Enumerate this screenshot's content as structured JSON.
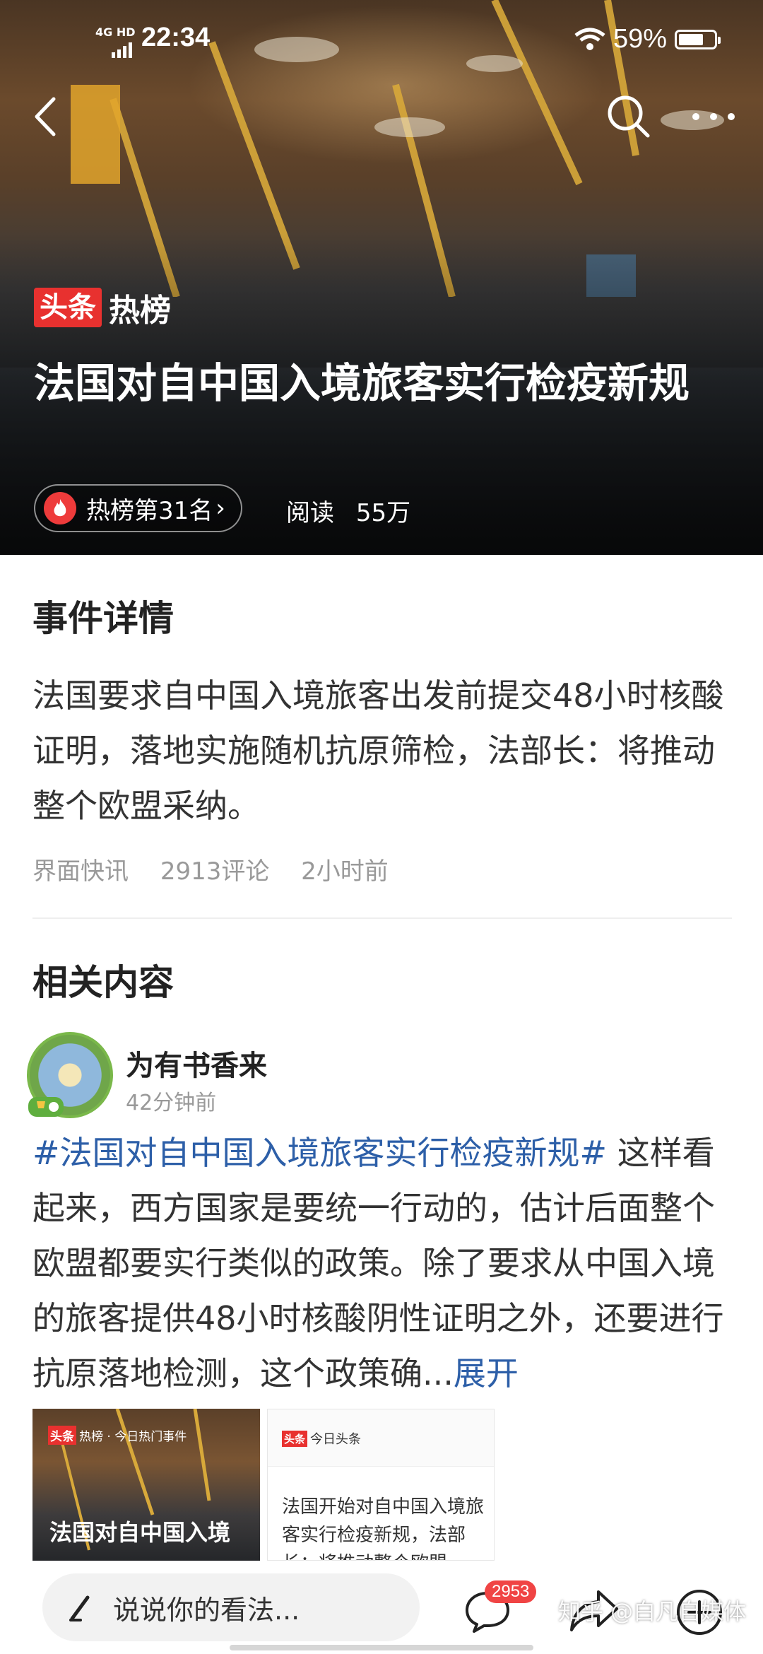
{
  "status_bar": {
    "network": "4G HD",
    "time": "22:34",
    "battery_percent": "59%"
  },
  "header": {
    "brand_red": "头条",
    "brand_hot": "热榜",
    "title": "法国对自中国入境旅客实行检疫新规",
    "rank_label": "热榜第31名",
    "reads_label": "阅读",
    "reads_value": "55万"
  },
  "event": {
    "section_title": "事件详情",
    "body": "法国要求自中国入境旅客出发前提交48小时核酸证明，落地实施随机抗原筛检，法部长：将推动整个欧盟采纳。",
    "source": "界面快讯",
    "comments": "2913评论",
    "time": "2小时前"
  },
  "related": {
    "section_title": "相关内容",
    "post": {
      "author": "为有书香来",
      "time": "42分钟前",
      "hashtag": "#法国对自中国入境旅客实行检疫新规#",
      "text": " 这样看起来，西方国家是要统一行动的，估计后面整个欧盟都要实行类似的政策。除了要求从中国入境的旅客提供48小时核酸阴性证明之外，还要进行抗原落地检测，这个政策确...",
      "expand": "展开",
      "thumb1": {
        "tag_red": "头条",
        "tag_text": "热榜 · 今日热门事件",
        "caption": "法国对自中国入境"
      },
      "thumb2": {
        "tag_red": "头条",
        "tag_text": "今日头条",
        "caption": "法国开始对自中国入境旅客实行检疫新规，法部长：将推动整个欧盟"
      }
    }
  },
  "bottom_bar": {
    "comment_placeholder": "说说你的看法...",
    "comment_count": "2953"
  },
  "watermark": "知乎 @白凡自媒体",
  "colors": {
    "accent_red": "#e8312f",
    "link_blue": "#2d5fa8",
    "badge_red": "#f04444"
  }
}
